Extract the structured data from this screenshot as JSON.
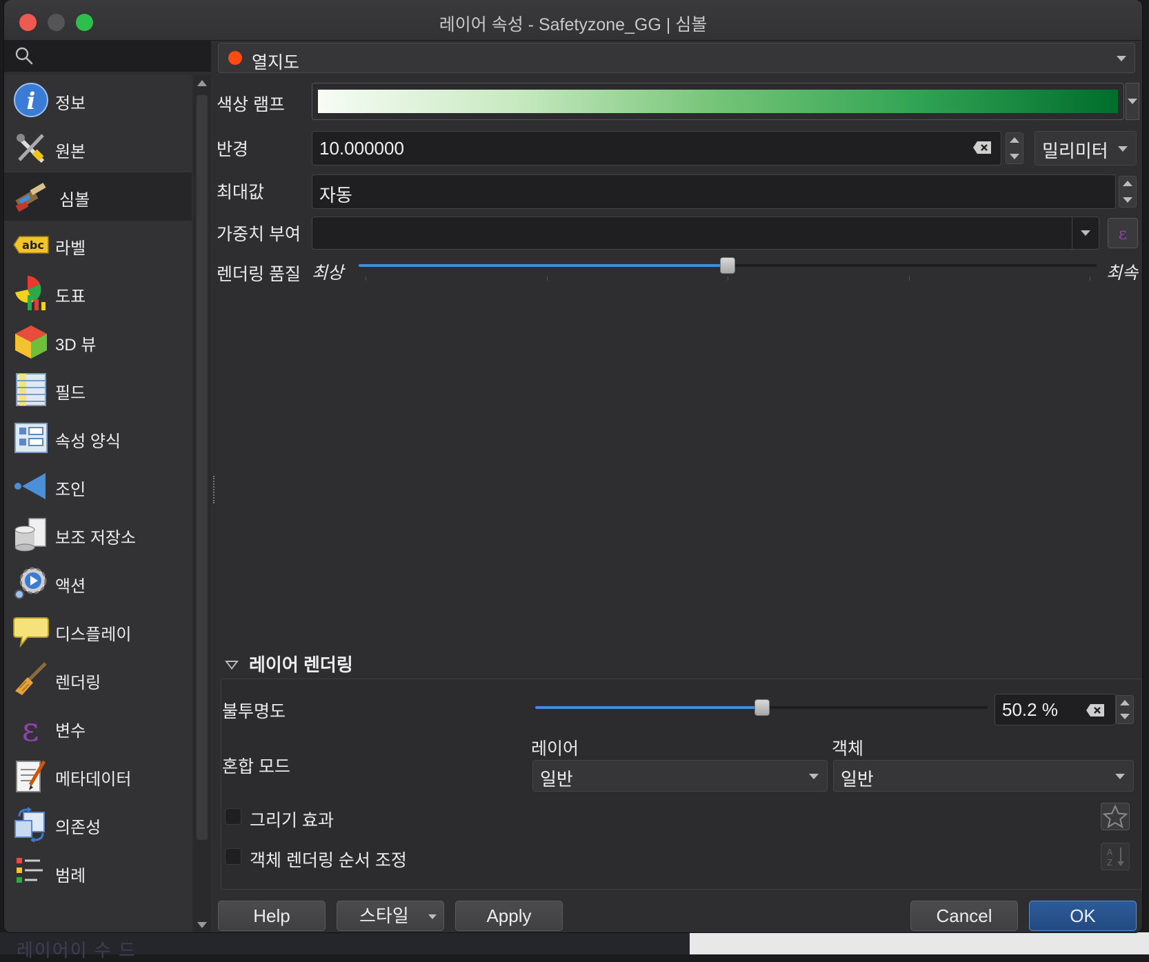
{
  "window": {
    "title": "레이어 속성 - Safetyzone_GG | 심볼"
  },
  "background": {
    "ghost_text": "레이어이 수 드"
  },
  "search": {
    "placeholder": ""
  },
  "sidebar": {
    "items": [
      {
        "label": "정보",
        "icon": "info-icon"
      },
      {
        "label": "원본",
        "icon": "source-tools-icon"
      },
      {
        "label": "심볼",
        "icon": "symbology-brush-icon",
        "selected": true
      },
      {
        "label": "라벨",
        "icon": "labels-abc-icon"
      },
      {
        "label": "도표",
        "icon": "diagrams-icon"
      },
      {
        "label": "3D 뷰",
        "icon": "3d-view-cube-icon"
      },
      {
        "label": "필드",
        "icon": "fields-table-icon"
      },
      {
        "label": "속성 양식",
        "icon": "attributes-form-icon"
      },
      {
        "label": "조인",
        "icon": "joins-icon"
      },
      {
        "label": "보조 저장소",
        "icon": "auxiliary-storage-icon"
      },
      {
        "label": "액션",
        "icon": "actions-gear-icon"
      },
      {
        "label": "디스플레이",
        "icon": "display-speech-bubble-icon"
      },
      {
        "label": "렌더링",
        "icon": "rendering-brush-icon"
      },
      {
        "label": "변수",
        "icon": "variables-epsilon-icon"
      },
      {
        "label": "메타데이터",
        "icon": "metadata-notepad-icon"
      },
      {
        "label": "의존성",
        "icon": "dependencies-icon"
      },
      {
        "label": "범례",
        "icon": "legend-icon"
      }
    ]
  },
  "renderer": {
    "selected": "열지도",
    "icon": "heatmap-dot-icon",
    "dot_color": "#ff4a12"
  },
  "color_ramp": {
    "label": "색상 램프",
    "stops": [
      "#f7fcf5",
      "#c7e9c0",
      "#74c476",
      "#31a354",
      "#006d2c"
    ]
  },
  "radius": {
    "label": "반경",
    "value": "10.000000",
    "unit": "밀리미터"
  },
  "max_value": {
    "label": "최대값",
    "value": "자동"
  },
  "weight": {
    "label": "가중치 부여",
    "value": ""
  },
  "quality": {
    "label": "렌더링 품질",
    "min_label": "최상",
    "max_label": "최속",
    "level": 0.5
  },
  "layer_rendering": {
    "title": "레이어 렌더링",
    "opacity_label": "불투명도",
    "opacity_value": "50.2 %",
    "opacity_fraction": 0.502,
    "blend_label": "혼합 모드",
    "layer_col": "레이어",
    "object_col": "객체",
    "layer_blend": "일반",
    "object_blend": "일반",
    "draw_effects": "그리기 효과",
    "order_by": "객체 렌더링 순서 조정"
  },
  "buttons": {
    "help": "Help",
    "style": "스타일",
    "apply": "Apply",
    "cancel": "Cancel",
    "ok": "OK"
  },
  "colors": {
    "accent": "#3f8ce0",
    "ok_button": "#2d5a97"
  }
}
